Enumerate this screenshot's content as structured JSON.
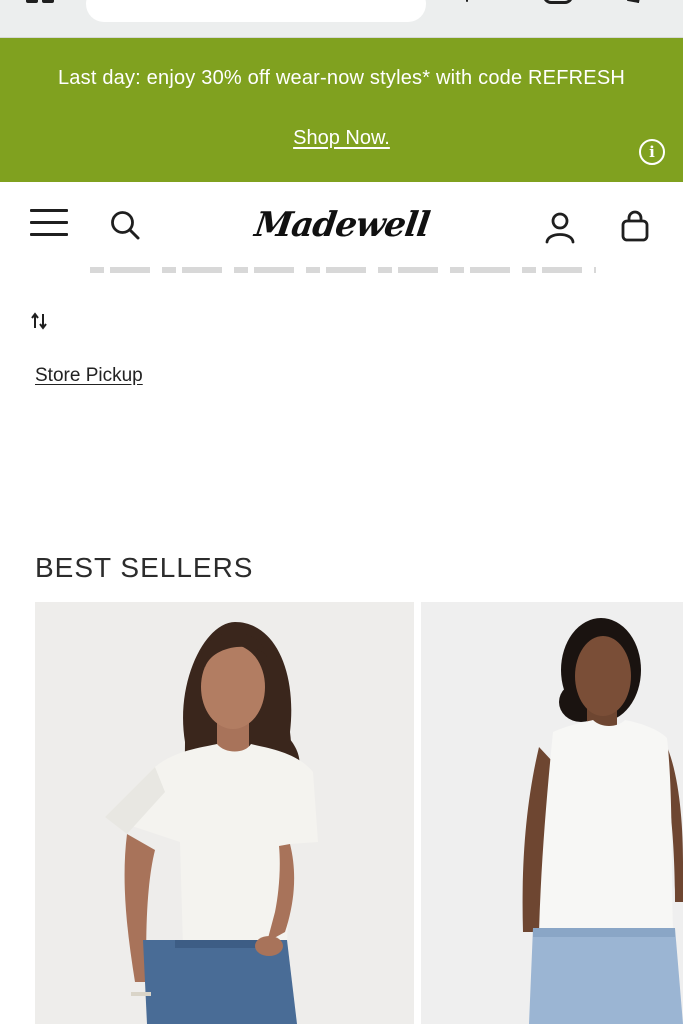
{
  "browser": {
    "url_field_value": ""
  },
  "promo": {
    "message": "Last day: enjoy 30% off wear-now styles* with code REFRESH",
    "link_label": "Shop Now.",
    "info_glyph": "i",
    "background_color": "#80a11f"
  },
  "header": {
    "logo_text": "Madewell",
    "icons": [
      "menu-icon",
      "search-icon",
      "account-icon",
      "bag-icon"
    ]
  },
  "filters": {
    "sort_icon": "sort-icon",
    "store_pickup_label": "Store Pickup"
  },
  "best_sellers": {
    "title": "BEST SELLERS",
    "products": [
      {
        "image": "model in white short-sleeve t-shirt and jeans"
      },
      {
        "image": "model in white sleeveless tank top and jeans"
      }
    ]
  }
}
